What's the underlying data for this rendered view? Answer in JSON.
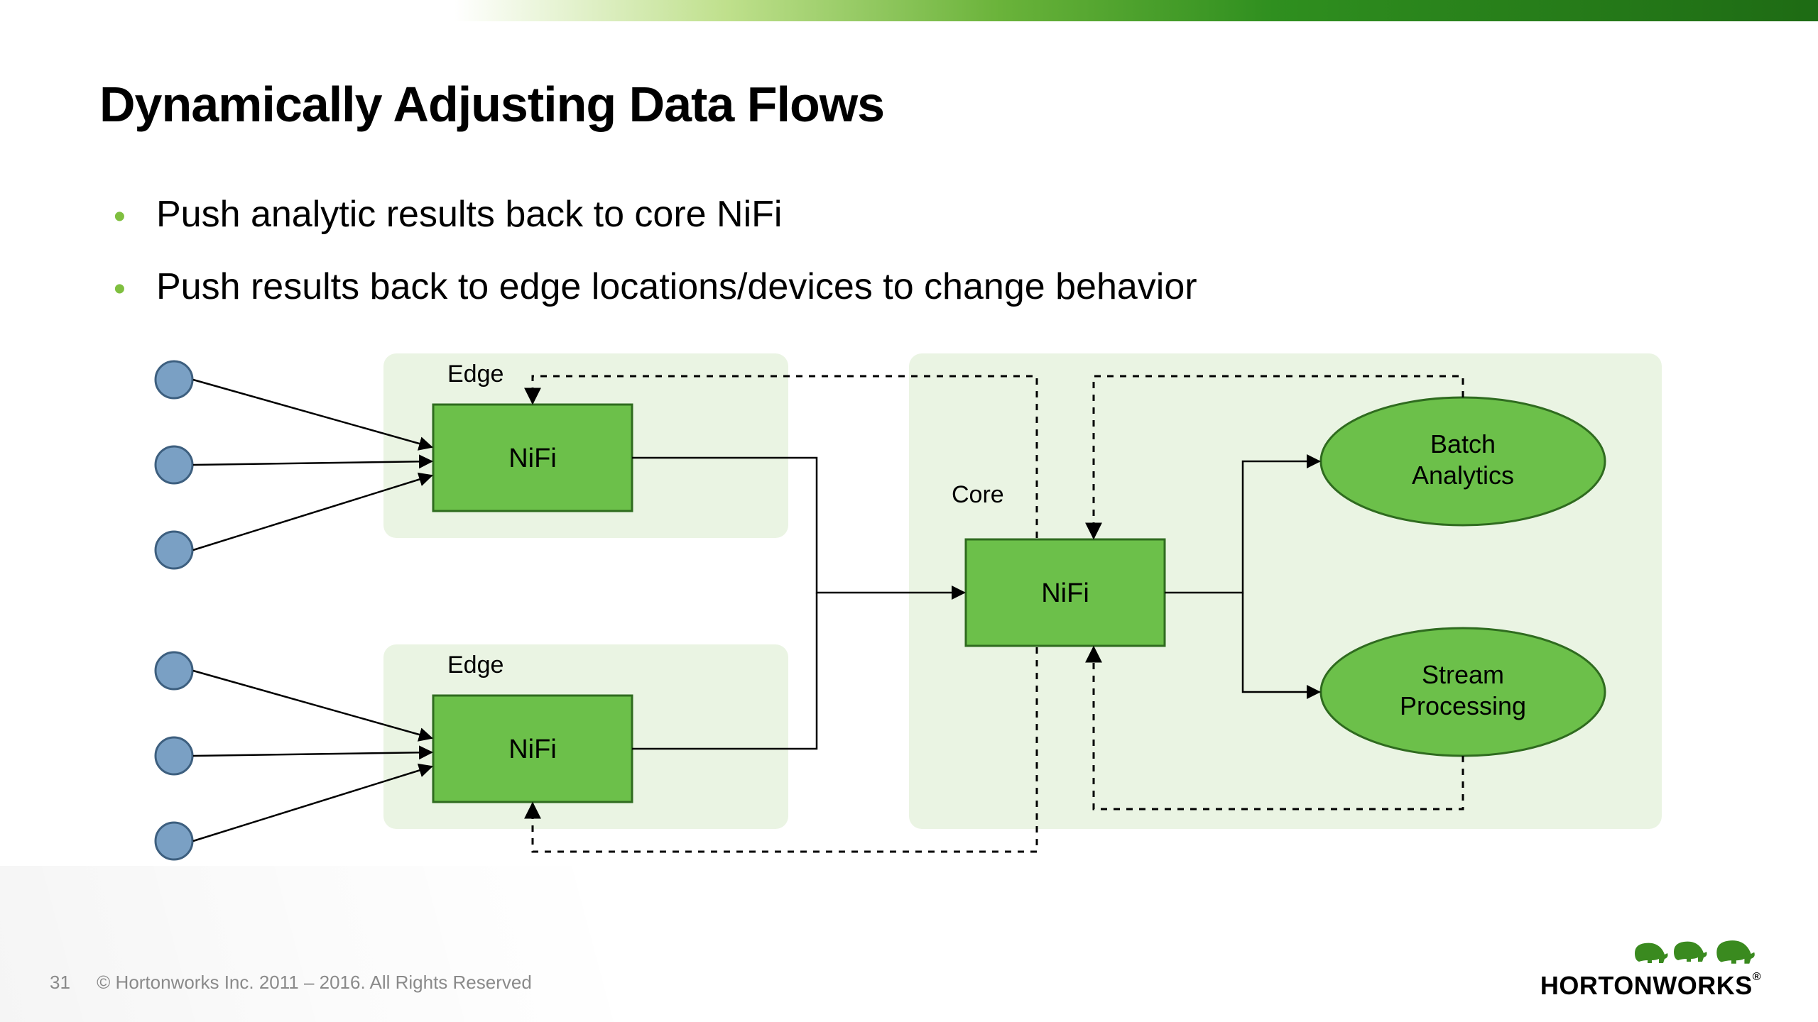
{
  "title": "Dynamically Adjusting Data Flows",
  "bullets": [
    "Push analytic results back to core NiFi",
    "Push results back to edge locations/devices to change behavior"
  ],
  "diagram": {
    "edge_label": "Edge",
    "core_label": "Core",
    "nifi_label": "NiFi",
    "batch_label_1": "Batch",
    "batch_label_2": "Analytics",
    "stream_label_1": "Stream",
    "stream_label_2": "Processing",
    "colors": {
      "node_fill": "#6cc04a",
      "node_stroke": "#2f6b1f",
      "group_fill": "#eaf4e3",
      "source_fill": "#7aa0c4",
      "source_stroke": "#3d5f7f",
      "line": "#000000"
    }
  },
  "footer": {
    "page_number": "31",
    "copyright": "© Hortonworks Inc. 2011 – 2016. All Rights Reserved"
  },
  "logo": {
    "text": "HORTONWORKS"
  }
}
